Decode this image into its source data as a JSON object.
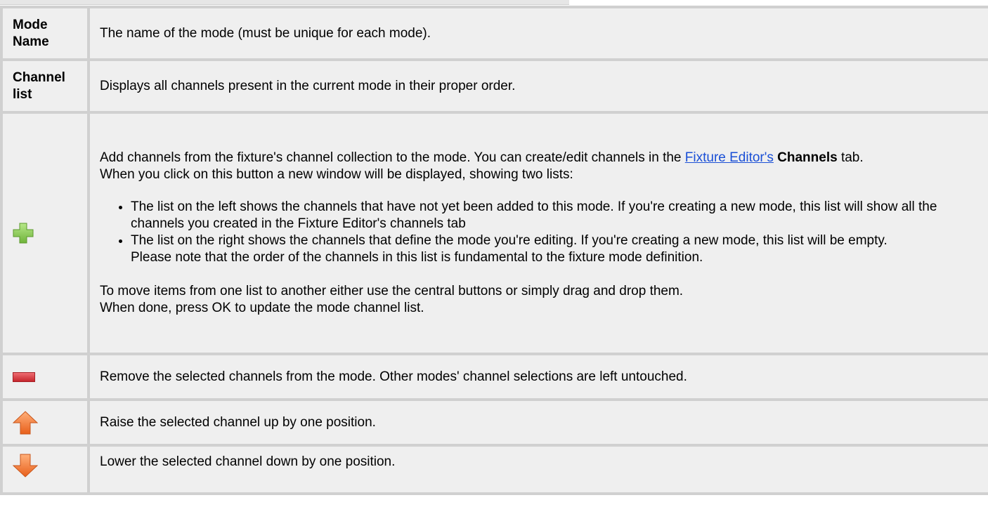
{
  "table": {
    "rows": [
      {
        "label_line1": "Mode",
        "label_line2": "Name",
        "description": "The name of the mode (must be unique for each mode)."
      },
      {
        "label_line1": "Channel",
        "label_line2": "list",
        "description": "Displays all channels present in the current mode in their proper order."
      },
      {
        "icon": "add-plus-icon",
        "intro_before_link": "Add channels from the fixture's channel collection to the mode. You can create/edit channels in the ",
        "link_text": "Fixture Editor's",
        "bold_text": "Channels",
        "intro_after": " tab.",
        "line2": "When you click on this button a new window will be displayed, showing two lists:",
        "bullets": [
          "The list on the left shows the channels that have not yet been added to this mode. If you're creating a new mode, this list will show all the channels you created in the Fixture Editor's channels tab",
          "The list on the right shows the channels that define the mode you're editing. If you're creating a new mode, this list will be empty."
        ],
        "bullet_note": "Please note that the order of the channels in this list is fundamental to the fixture mode definition.",
        "outro_line1": "To move items from one list to another either use the central buttons or simply drag and drop them.",
        "outro_line2": "When done, press OK to update the mode channel list."
      },
      {
        "icon": "remove-minus-icon",
        "description": "Remove the selected channels from the mode. Other modes' channel selections are left untouched."
      },
      {
        "icon": "arrow-up-icon",
        "description": "Raise the selected channel up by one position."
      },
      {
        "icon": "arrow-down-icon",
        "description": "Lower the selected channel down by one position."
      }
    ]
  },
  "colors": {
    "link": "#1a4fd6",
    "cell_background": "#efefef",
    "grid": "#d0d0d0",
    "plus_icon": "#8fd14f",
    "minus_icon": "#d9343b",
    "arrow_icon": "#f07c2a"
  }
}
